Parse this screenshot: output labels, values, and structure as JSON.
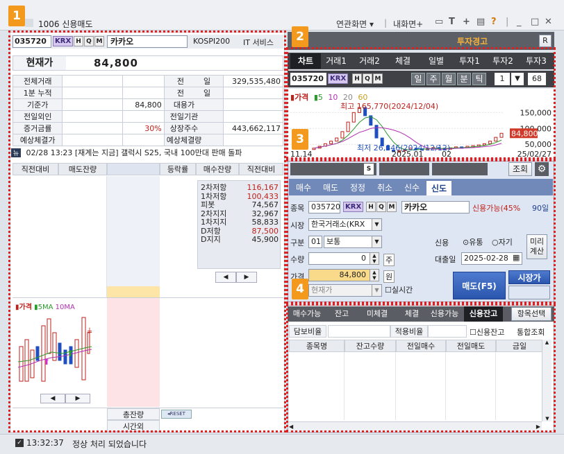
{
  "window": {
    "title": "1006  신용매도",
    "related_screen": "연관화면",
    "my_screen": "내화면+",
    "icons": [
      "monitor-icon",
      "text-icon",
      "plus-icon",
      "print-icon",
      "help-icon",
      "minimize-icon",
      "maximize-icon",
      "close-icon"
    ]
  },
  "badges": [
    "1",
    "2",
    "3",
    "4"
  ],
  "stock": {
    "code": "035720",
    "market": "KRX",
    "btn_h": "H",
    "btn_q": "Q",
    "btn_m": "M",
    "name": "카카오",
    "index": "KOSPI200",
    "sector": "IT 서비스"
  },
  "price": {
    "label": "현재가",
    "value": "84,800"
  },
  "info_rows": [
    {
      "l1": "전체거래",
      "v1": "",
      "v1b": "",
      "l2": "전",
      "l2b": "일",
      "v2": "329,535,480"
    },
    {
      "l1": "1분 누적",
      "v1": "",
      "v1b": "",
      "l2": "전",
      "l2b": "일",
      "v2": ""
    },
    {
      "l1": "기준가",
      "v1": "",
      "v1b": "84,800",
      "l2": "대용가",
      "l2b": "",
      "v2": ""
    },
    {
      "l1": "전일외인",
      "v1": "",
      "v1b": "",
      "l2": "전일기관",
      "l2b": "",
      "v2": ""
    },
    {
      "l1": "증거금률",
      "v1": "",
      "v1b": "30%",
      "l2": "상장주수",
      "l2b": "",
      "v2": "443,662,117"
    },
    {
      "l1": "예상체결가",
      "v1": "",
      "v1b": "",
      "l2": "예상체결량",
      "l2b": "",
      "v2": ""
    }
  ],
  "news": {
    "icon": "뉴",
    "text": "02/28 13:23 [재계는 지금] 갤럭시 S25, 국내 100만대 판매 돌파"
  },
  "orderbook": {
    "headers": [
      "직전대비",
      "매도잔량",
      "",
      "등락률",
      "매수잔량",
      "직전대비"
    ],
    "pivot": [
      {
        "label": "2차저항",
        "value": "116,167",
        "color": "#c0201a"
      },
      {
        "label": "1차저항",
        "value": "100,433",
        "color": "#c0201a"
      },
      {
        "label": "피봇",
        "value": "74,567",
        "color": "#222"
      },
      {
        "label": "2차지지",
        "value": "32,967",
        "color": "#222"
      },
      {
        "label": "1차지지",
        "value": "58,833",
        "color": "#222"
      },
      {
        "label": "D저항",
        "value": "87,500",
        "color": "#c0201a"
      },
      {
        "label": "D지지",
        "value": "45,900",
        "color": "#222"
      }
    ],
    "mini_chart_legend": {
      "price": "가격",
      "ma5": "5MA",
      "ma10": "10MA"
    },
    "total_label": "총잔량",
    "reset_label": "RESET",
    "after_hours_label": "시간외"
  },
  "panel2": {
    "warning": "투자경고",
    "r_button": "R",
    "tabs": [
      "차트",
      "거래1",
      "거래2",
      "체결",
      "일별",
      "투자1",
      "투자2",
      "투자3"
    ],
    "code": "035720",
    "periods": [
      "일",
      "주",
      "월",
      "분",
      "틱"
    ],
    "count_value": "1",
    "count_suffix": "68"
  },
  "chart_data": {
    "type": "line",
    "title": "가격",
    "ma_legend": [
      "5",
      "10",
      "20",
      "60"
    ],
    "x_ticks": [
      "11.14",
      "2025.01",
      "02",
      "25/02/27"
    ],
    "y_ticks": [
      "150,000",
      "100,000",
      "50,000"
    ],
    "ylim": [
      20000,
      190000
    ],
    "current_price_label": "84,800",
    "high_label": "최고 165,770(2024/12/04)",
    "low_label": "최저 26,846(2024/12/12)",
    "series": [
      {
        "values": [
          38000,
          44000,
          52000,
          60000,
          70000,
          90000,
          120000,
          150000,
          165770,
          140000,
          110000,
          70000,
          45000,
          32000,
          26846,
          30000,
          34000,
          38000,
          36000,
          34000,
          37000,
          40000,
          38000,
          36000,
          39000,
          42000,
          41000,
          44000,
          46000,
          48000,
          52000,
          60000,
          72000,
          84800
        ]
      }
    ]
  },
  "order": {
    "lookup_button": "조회",
    "tabs": [
      "매수",
      "매도",
      "정정",
      "취소",
      "신수",
      "신도"
    ],
    "active_tab": "신도",
    "label_code": "종목",
    "code": "035720",
    "name": "카카오",
    "credit_info": "신용가능(45%",
    "credit_days": "90일",
    "label_market": "시장",
    "market": "한국거래소(KRX",
    "label_type": "구분",
    "type_code": "01",
    "type_name": "보통",
    "credit_label": "신용",
    "radio_yutong": "유통",
    "radio_jagi": "자기",
    "calc_button": "미리계산",
    "label_qty": "수량",
    "qty": "0",
    "qty_unit": "주",
    "loan_date_label": "대출일",
    "loan_date": "2025-02-28",
    "label_price": "가격",
    "price": "84,800",
    "price_unit": "원",
    "price_type": "현재가",
    "realtime_label": "실시간",
    "sell_button": "매도(F5)",
    "market_price_button": "시장가"
  },
  "balance": {
    "tabs": [
      "매수가능",
      "잔고",
      "미체결",
      "체결",
      "신용가능",
      "신용잔고"
    ],
    "active_tab": "신용잔고",
    "select_button": "항목선택",
    "collateral_label": "담보비율",
    "applied_label": "적용비율",
    "credit_only_label": "신용잔고",
    "consolidated_label": "통합조회",
    "headers": [
      "종목명",
      "잔고수량",
      "전일매수",
      "전일매도",
      "금일"
    ]
  },
  "status": {
    "time": "13:32:37",
    "message": "정상 처리 되었습니다"
  }
}
